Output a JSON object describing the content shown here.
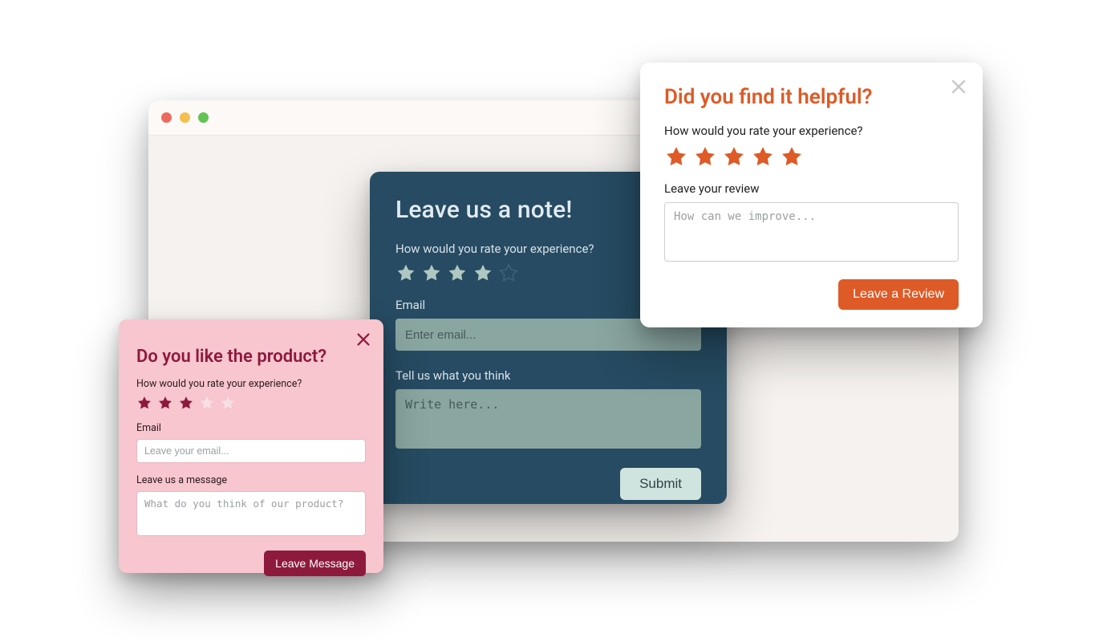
{
  "navy": {
    "title": "Leave us a note!",
    "rating_label": "How would you rate your experience?",
    "rating": 4,
    "max_rating": 5,
    "email_label": "Email",
    "email_placeholder": "Enter email...",
    "message_label": "Tell us what you think",
    "message_placeholder": "Write here...",
    "submit_label": "Submit"
  },
  "pink": {
    "title": "Do you like the product?",
    "rating_label": "How would you rate your experience?",
    "rating": 3,
    "max_rating": 5,
    "email_label": "Email",
    "email_placeholder": "Leave your email...",
    "message_label": "Leave us a message",
    "message_placeholder": "What do you think of our product?",
    "submit_label": "Leave Message"
  },
  "white": {
    "title": "Did you find it helpful?",
    "rating_label": "How would you rate your experience?",
    "rating": 5,
    "max_rating": 5,
    "review_label": "Leave your review",
    "review_placeholder": "How can we improve...",
    "submit_label": "Leave a Review"
  }
}
